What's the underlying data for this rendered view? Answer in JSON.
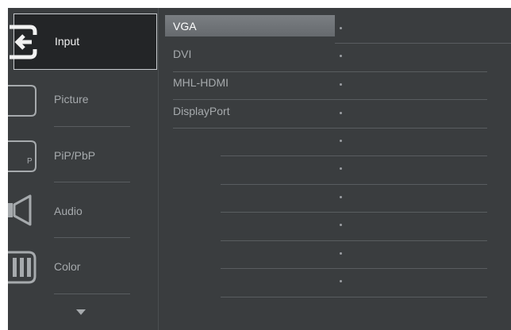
{
  "menu": {
    "items": [
      {
        "label": "Input",
        "icon": "input-icon",
        "selected": true
      },
      {
        "label": "Picture",
        "icon": "picture-icon",
        "selected": false
      },
      {
        "label": "PiP/PbP",
        "icon": "pip-icon",
        "icon_text": "P",
        "selected": false
      },
      {
        "label": "Audio",
        "icon": "speaker-icon",
        "selected": false
      },
      {
        "label": "Color",
        "icon": "color-icon",
        "selected": false
      }
    ],
    "scroll_down_icon": "triangle-down-icon"
  },
  "submenu": {
    "items": [
      {
        "label": "VGA",
        "selected": true
      },
      {
        "label": "DVI",
        "selected": false
      },
      {
        "label": "MHL-HDMI",
        "selected": false
      },
      {
        "label": "DisplayPort",
        "selected": false
      },
      {
        "label": "",
        "selected": false
      },
      {
        "label": "",
        "selected": false
      },
      {
        "label": "",
        "selected": false
      },
      {
        "label": "",
        "selected": false
      },
      {
        "label": "",
        "selected": false
      },
      {
        "label": "",
        "selected": false
      }
    ]
  },
  "colors": {
    "background": "#3a3d3f",
    "selected_menu_bg": "#232527",
    "selected_sub_bg": "#727679",
    "text": "#a6aaad",
    "text_selected": "#ffffff"
  }
}
